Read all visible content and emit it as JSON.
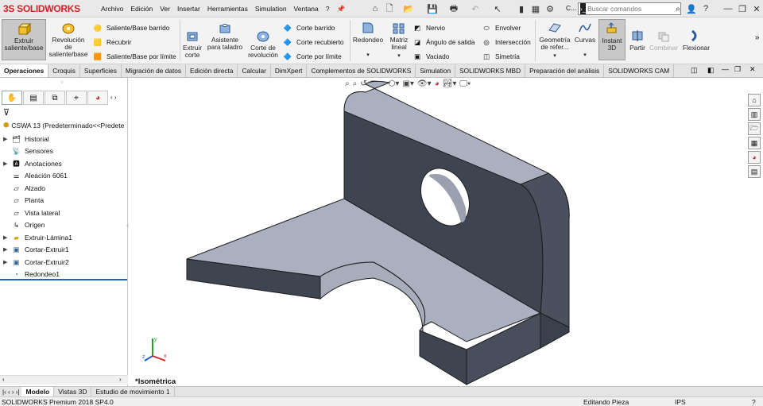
{
  "app": {
    "logo": "SOLIDWORKS",
    "logo_prefix": "3S"
  },
  "menu": [
    "Archivo",
    "Edición",
    "Ver",
    "Insertar",
    "Herramientas",
    "Simulation",
    "Ventana",
    "?"
  ],
  "menu_right": {
    "truncated": "C...",
    "search_placeholder": "Buscar comandos"
  },
  "ribbon": {
    "extrude": "Extruir saliente/base",
    "revolve": "Revolución de saliente/base",
    "swept": "Saliente/Base barrido",
    "loft": "Recubrir",
    "boundary": "Saliente/Base por límite",
    "extrude_cut": "Extruir corte",
    "hole_wizard": "Asistente para taladro",
    "revolve_cut": "Corte de revolución",
    "swept_cut": "Corte barrido",
    "loft_cut": "Corte recubierto",
    "boundary_cut": "Corte por límite",
    "fillet": "Redondeo",
    "pattern": "Matriz lineal",
    "rib": "Nervio",
    "draft": "Ángulo de salida",
    "shell": "Vaciado",
    "wrap": "Envolver",
    "intersect": "Intersección",
    "mirror": "Simetría",
    "ref_geom": "Geometría de refer...",
    "curves": "Curvas",
    "instant3d": "Instant 3D",
    "split": "Partir",
    "combine": "Combinar",
    "flex": "Flexionar"
  },
  "tabs": [
    "Operaciones",
    "Croquis",
    "Superficies",
    "Migración de datos",
    "Edición directa",
    "Calcular",
    "DimXpert",
    "Complementos de SOLIDWORKS",
    "Simulation",
    "SOLIDWORKS MBD",
    "Preparación del análisis",
    "SOLIDWORKS CAM"
  ],
  "tree": {
    "root": "CSWA 13  (Predeterminado<<Predete",
    "items": [
      "Historial",
      "Sensores",
      "Anotaciones",
      "Aleación 6061",
      "Alzado",
      "Planta",
      "Vista lateral",
      "Origen",
      "Extruir-Lámina1",
      "Cortar-Extruir1",
      "Cortar-Extruir2",
      "Redondeo1"
    ]
  },
  "viewport": {
    "view_name": "*Isométrica"
  },
  "bottom_tabs": [
    "Modelo",
    "Vistas 3D",
    "Estudio de movimiento 1"
  ],
  "status": {
    "version": "SOLIDWORKS Premium 2018 SP4.0",
    "mode": "Editando Pieza",
    "units": "IPS"
  },
  "colors": {
    "accent": "#d61f26",
    "selection": "#1e64c8",
    "part_face_front": "#3e4450",
    "part_face_top": "#a9aebd"
  }
}
